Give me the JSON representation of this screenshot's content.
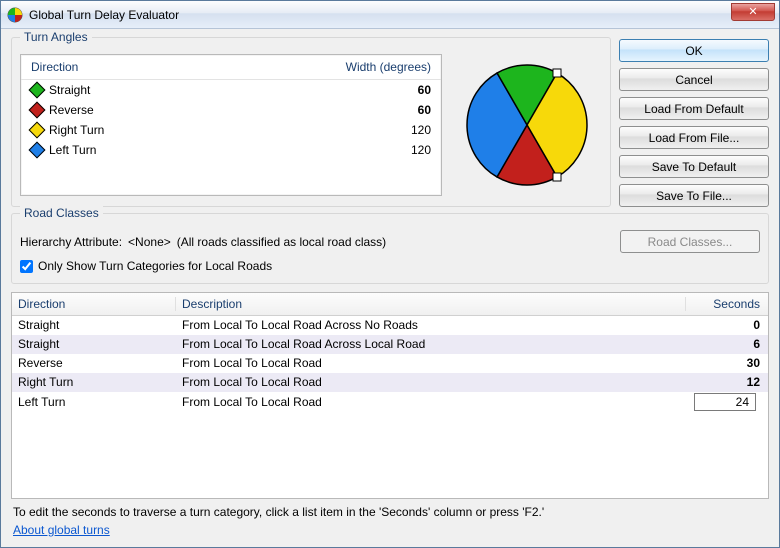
{
  "window": {
    "title": "Global Turn Delay Evaluator",
    "close_symbol": "✕"
  },
  "turn_angles": {
    "title": "Turn Angles",
    "header_direction": "Direction",
    "header_width": "Width (degrees)",
    "rows": [
      {
        "label": "Straight",
        "value": "60",
        "bold": true
      },
      {
        "label": "Reverse",
        "value": "60",
        "bold": true
      },
      {
        "label": "Right Turn",
        "value": "120",
        "bold": false
      },
      {
        "label": "Left Turn",
        "value": "120",
        "bold": false
      }
    ]
  },
  "chart_data": {
    "type": "pie",
    "title": "",
    "series": [
      {
        "name": "Straight",
        "value": 60,
        "color": "#1db51d"
      },
      {
        "name": "Right Turn",
        "value": 120,
        "color": "#f7d90a"
      },
      {
        "name": "Reverse",
        "value": 60,
        "color": "#c2201c"
      },
      {
        "name": "Left Turn",
        "value": 120,
        "color": "#1f7fe8"
      }
    ]
  },
  "buttons": {
    "ok": "OK",
    "cancel": "Cancel",
    "load_default": "Load From Default",
    "load_file": "Load From File...",
    "save_default": "Save To Default",
    "save_file": "Save To File..."
  },
  "road_classes": {
    "title": "Road Classes",
    "hierarchy_label": "Hierarchy Attribute:",
    "hierarchy_value": "<None>",
    "hierarchy_suffix": "(All roads classified as local road class)",
    "button": "Road Classes...",
    "checkbox_label": "Only Show Turn Categories for Local Roads"
  },
  "grid": {
    "header_direction": "Direction",
    "header_description": "Description",
    "header_seconds": "Seconds",
    "rows": [
      {
        "dir": "Straight",
        "desc": "From Local To Local Road Across No Roads",
        "sec": "0",
        "bold": true
      },
      {
        "dir": "Straight",
        "desc": "From Local To Local Road Across Local Road",
        "sec": "6",
        "bold": true
      },
      {
        "dir": "Reverse",
        "desc": "From Local To Local Road",
        "sec": "30",
        "bold": true
      },
      {
        "dir": "Right Turn",
        "desc": "From Local To Local Road",
        "sec": "12",
        "bold": true
      },
      {
        "dir": "Left Turn",
        "desc": "From Local To Local Road",
        "sec": "24",
        "bold": false,
        "editing": true
      }
    ]
  },
  "hint": "To edit the seconds to traverse a turn category, click a list item in the 'Seconds' column or press 'F2.'",
  "link": "About global turns"
}
